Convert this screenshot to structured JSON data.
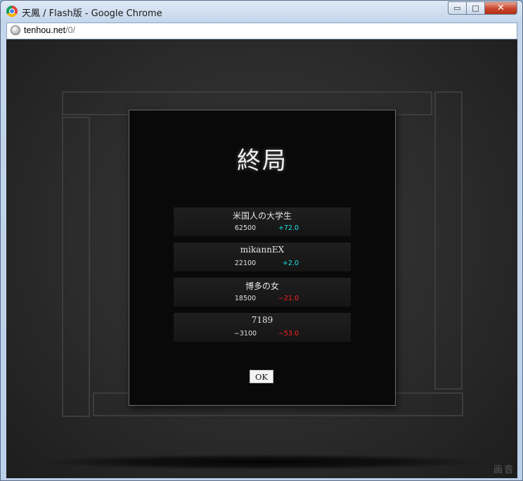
{
  "window": {
    "title": "天鳳 / Flash版 - Google Chrome",
    "buttons": {
      "minimize": "▭",
      "maximize": "□",
      "close": "✕"
    }
  },
  "address_bar": {
    "host": "tenhou.net",
    "path": "/0/"
  },
  "game": {
    "result_title": "終局",
    "players": [
      {
        "name": "米国人の大学生",
        "score": "62500",
        "delta": "+72.0",
        "delta_color": "#19e6e6"
      },
      {
        "name": "mikannEX",
        "score": "22100",
        "delta": "+2.0",
        "delta_color": "#19e6e6"
      },
      {
        "name": "博多の女",
        "score": "18500",
        "delta": "−21.0",
        "delta_color": "#ff2020"
      },
      {
        "name": "7189",
        "score": "−3100",
        "delta": "−53.0",
        "delta_color": "#ff2020"
      }
    ],
    "ok_label": "OK",
    "sound_label": "画音"
  }
}
